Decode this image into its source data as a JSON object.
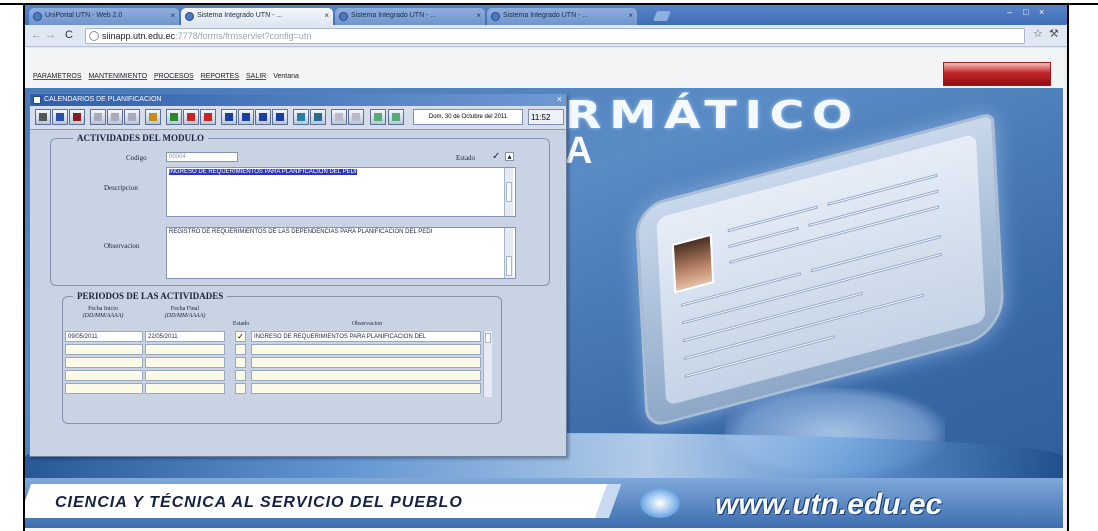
{
  "browser": {
    "tabs": [
      {
        "label": "UniPortal UTN - Web 2.0",
        "active": false
      },
      {
        "label": "Sistema Integrado UTN - ...",
        "active": true
      },
      {
        "label": "Sistema Integrado UTN - ...",
        "active": false
      },
      {
        "label": "Sistema Integrado UTN - ...",
        "active": false
      }
    ],
    "url_host": "siinapp.utn.edu.ec",
    "url_path": ":7778/forms/frmservlet?config=utn"
  },
  "menu": [
    "PARAMETROS",
    "MANTENIMIENTO",
    "PROCESOS",
    "REPORTES",
    "SALIR",
    "Ventana"
  ],
  "banner": {
    "headline": "RMÁTICO",
    "headline2": "A",
    "slogan": "CIENCIA Y TÉCNICA AL SERVICIO DEL PUEBLO",
    "website": "www.utn.edu.ec"
  },
  "dialog": {
    "title": "CALENDARIOS DE PLANIFICACION",
    "date": "Dom, 30 de Octubre del 2011",
    "time": "11:52",
    "actividades": {
      "group_title": "ACTIVIDADES DEL MODULO",
      "codigo_label": "Codigo",
      "codigo_value": "00004",
      "estado_label": "Estado",
      "estado_checked": "✓",
      "descripcion_label": "Descripcion",
      "descripcion_value": "INGRESO DE REQUERIMIENTOS PARA PLANIFICACION DEL PEDI",
      "observacion_label": "Observacion",
      "observacion_value": "REGISTRO DE REQUERIMIENTOS DE LAS DEPENDENCIAS PARA PLANIFICACION DEL PEDI"
    },
    "periodos": {
      "group_title": "PERIODOS DE LAS ACTIVIDADES",
      "col_inicio": "Fecha Inicio",
      "col_inicio_fmt": "(DD/MM/AAAA)",
      "col_final": "Fecha Final",
      "col_final_fmt": "(DD/MM/AAAA)",
      "col_estado": "Estado",
      "col_obs": "Observacion",
      "rows": [
        {
          "inicio": "09/05/2011",
          "final": "22/05/2011",
          "estado": "✓",
          "obs": "INGRESO DE REQUERIMIENTOS PARA PLANIFICACION DEL"
        },
        {
          "inicio": "",
          "final": "",
          "estado": "",
          "obs": ""
        },
        {
          "inicio": "",
          "final": "",
          "estado": "",
          "obs": ""
        },
        {
          "inicio": "",
          "final": "",
          "estado": "",
          "obs": ""
        },
        {
          "inicio": "",
          "final": "",
          "estado": "",
          "obs": ""
        }
      ]
    }
  },
  "colors": {
    "title_bar": "#2f5fa8",
    "selection": "#2a35c8",
    "banner": "#4a79b5"
  }
}
